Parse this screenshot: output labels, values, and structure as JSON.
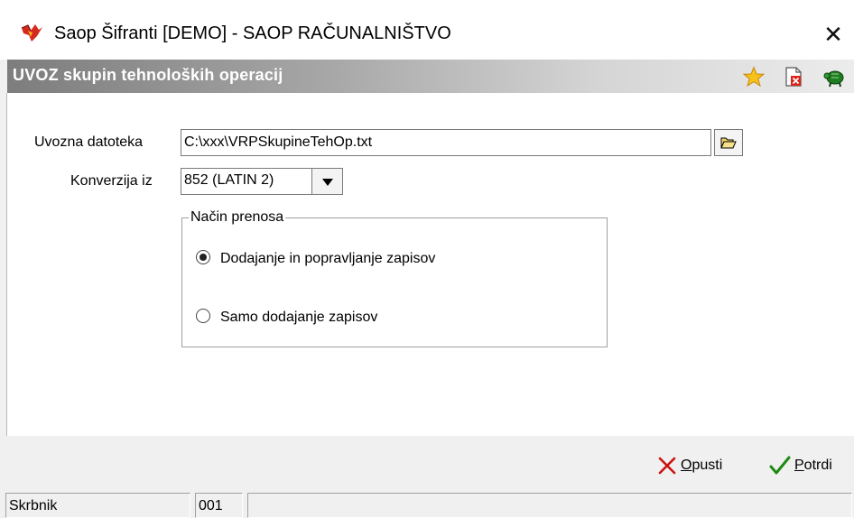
{
  "window": {
    "title": "Saop Šifranti [DEMO] - SAOP RAČUNALNIŠTVO",
    "close_glyph": "✕"
  },
  "header": {
    "title": "UVOZ skupin tehnoloških operacij",
    "icons": [
      "star-icon",
      "delete-document-icon",
      "help-turtle-icon"
    ]
  },
  "form": {
    "import_file": {
      "label": "Uvozna datoteka",
      "value": "C:\\xxx\\VRPSkupineTehOp.txt"
    },
    "conversion": {
      "label": "Konverzija iz",
      "value": "852 (LATIN 2)"
    },
    "transfer_mode": {
      "legend": "Način prenosa",
      "options": [
        {
          "label": "Dodajanje in popravljanje zapisov",
          "checked": true
        },
        {
          "label": "Samo dodajanje zapisov",
          "checked": false
        }
      ]
    }
  },
  "buttons": {
    "cancel": {
      "first": "O",
      "rest": "pusti"
    },
    "confirm": {
      "first": "P",
      "rest": "otrdi"
    }
  },
  "statusbar": {
    "user": "Skrbnik",
    "code": "001",
    "info": ""
  },
  "colors": {
    "header_gradient_start": "#7d7d7d",
    "header_text": "#ffffff",
    "cancel_x": "#cc1111",
    "confirm_check": "#1d8a12"
  }
}
